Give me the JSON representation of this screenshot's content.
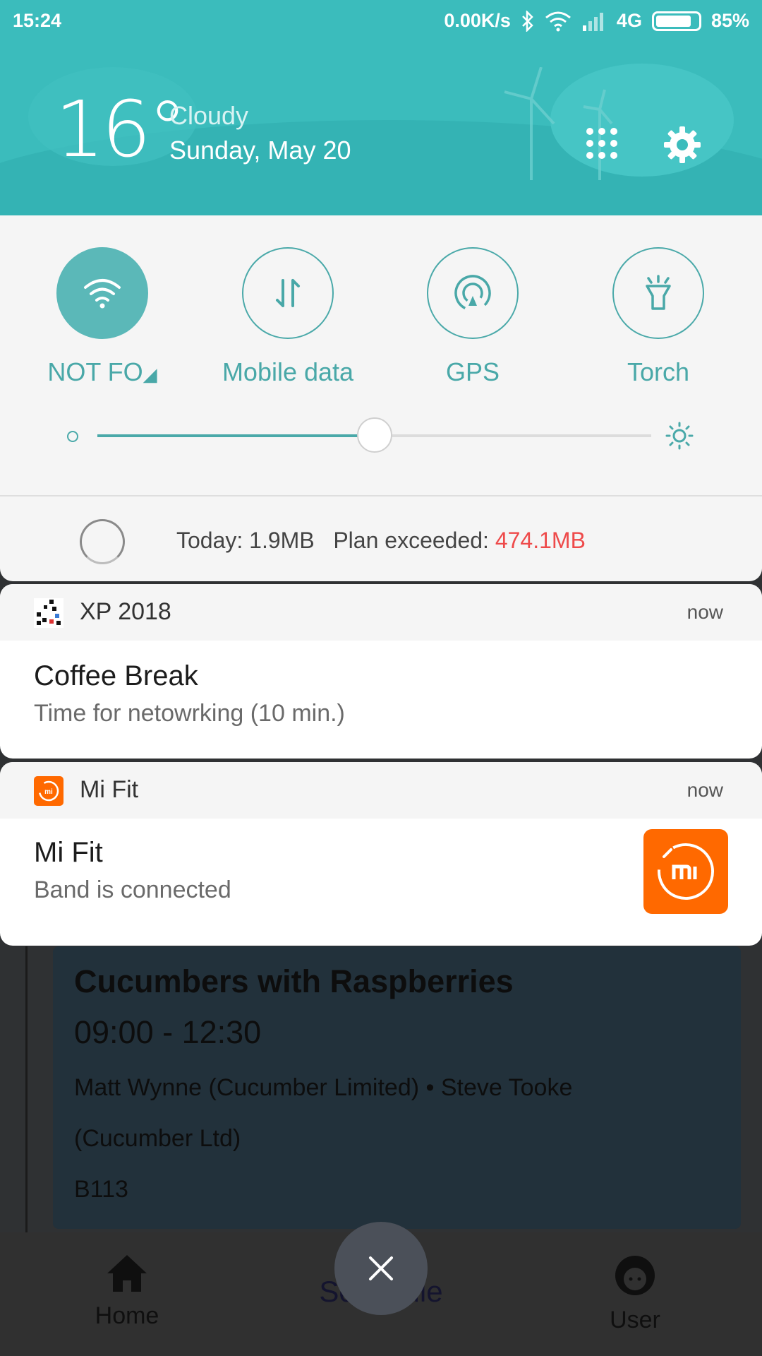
{
  "status_bar": {
    "time": "15:24",
    "net_speed": "0.00K/s",
    "network": "4G",
    "battery": "85%",
    "battery_level": 0.85
  },
  "weather": {
    "temperature": "16°",
    "condition": "Cloudy",
    "date": "Sunday, May 20"
  },
  "quick_settings": {
    "tiles": [
      {
        "label": "NOT FO",
        "icon": "wifi-icon",
        "active": true
      },
      {
        "label": "Mobile data",
        "icon": "mobile-data-icon",
        "active": false
      },
      {
        "label": "GPS",
        "icon": "gps-icon",
        "active": false
      },
      {
        "label": "Torch",
        "icon": "torch-icon",
        "active": false
      }
    ],
    "brightness_level": 0.5
  },
  "data_usage": {
    "today_label": "Today: 1.9MB",
    "plan_label": "Plan exceeded:",
    "plan_value": "474.1MB"
  },
  "notifications": [
    {
      "app": "XP 2018",
      "when": "now",
      "title": "Coffee Break",
      "body": "Time for netowrking (10 min.)"
    },
    {
      "app": "Mi Fit",
      "when": "now",
      "title": "Mi Fit",
      "body": "Band is connected"
    }
  ],
  "background_app": {
    "session_title": "Cucumbers with Raspberries",
    "time_range": "09:00 - 12:30",
    "speakers_line1": "Matt Wynne (Cucumber Limited) • Steve Tooke",
    "speakers_line2": "(Cucumber Ltd)",
    "room": "B113",
    "nav": {
      "home": "Home",
      "schedule": "Schedule",
      "user": "User"
    }
  },
  "colors": {
    "accent": "#49a8a8",
    "header": "#3bbcbc",
    "warning": "#ee4a4a",
    "mifit": "#ff6900"
  }
}
